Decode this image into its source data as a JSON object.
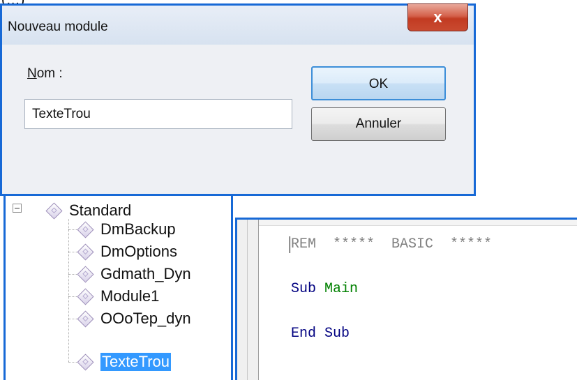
{
  "fragment": "(…)",
  "dialog": {
    "title": "Nouveau module",
    "close_glyph": "x",
    "name_label_underlined": "N",
    "name_label_rest": "om :",
    "name_value": "TexteTrou",
    "ok_label": "OK",
    "cancel_label": "Annuler",
    "accent_color": "#1769d6"
  },
  "tree": {
    "root_label": "Standard",
    "items": [
      {
        "label": "DmBackup"
      },
      {
        "label": "DmOptions"
      },
      {
        "label": "Gdmath_Dyn"
      },
      {
        "label": "Module1"
      },
      {
        "label": "OOoTep_dyn"
      },
      {
        "label": "TexteTrou",
        "selected": true
      }
    ],
    "selection_color": "#3399ff",
    "icon": "module-diamond-icon"
  },
  "editor": {
    "line1": {
      "keyword": "REM",
      "comment": "  *****  BASIC  *****"
    },
    "line2": {
      "keyword": "Sub",
      "name": "Main"
    },
    "line3": {
      "keyword": "End Sub"
    },
    "colors": {
      "keyword": "#000080",
      "comment": "#808080",
      "identifier": "#008000"
    }
  }
}
